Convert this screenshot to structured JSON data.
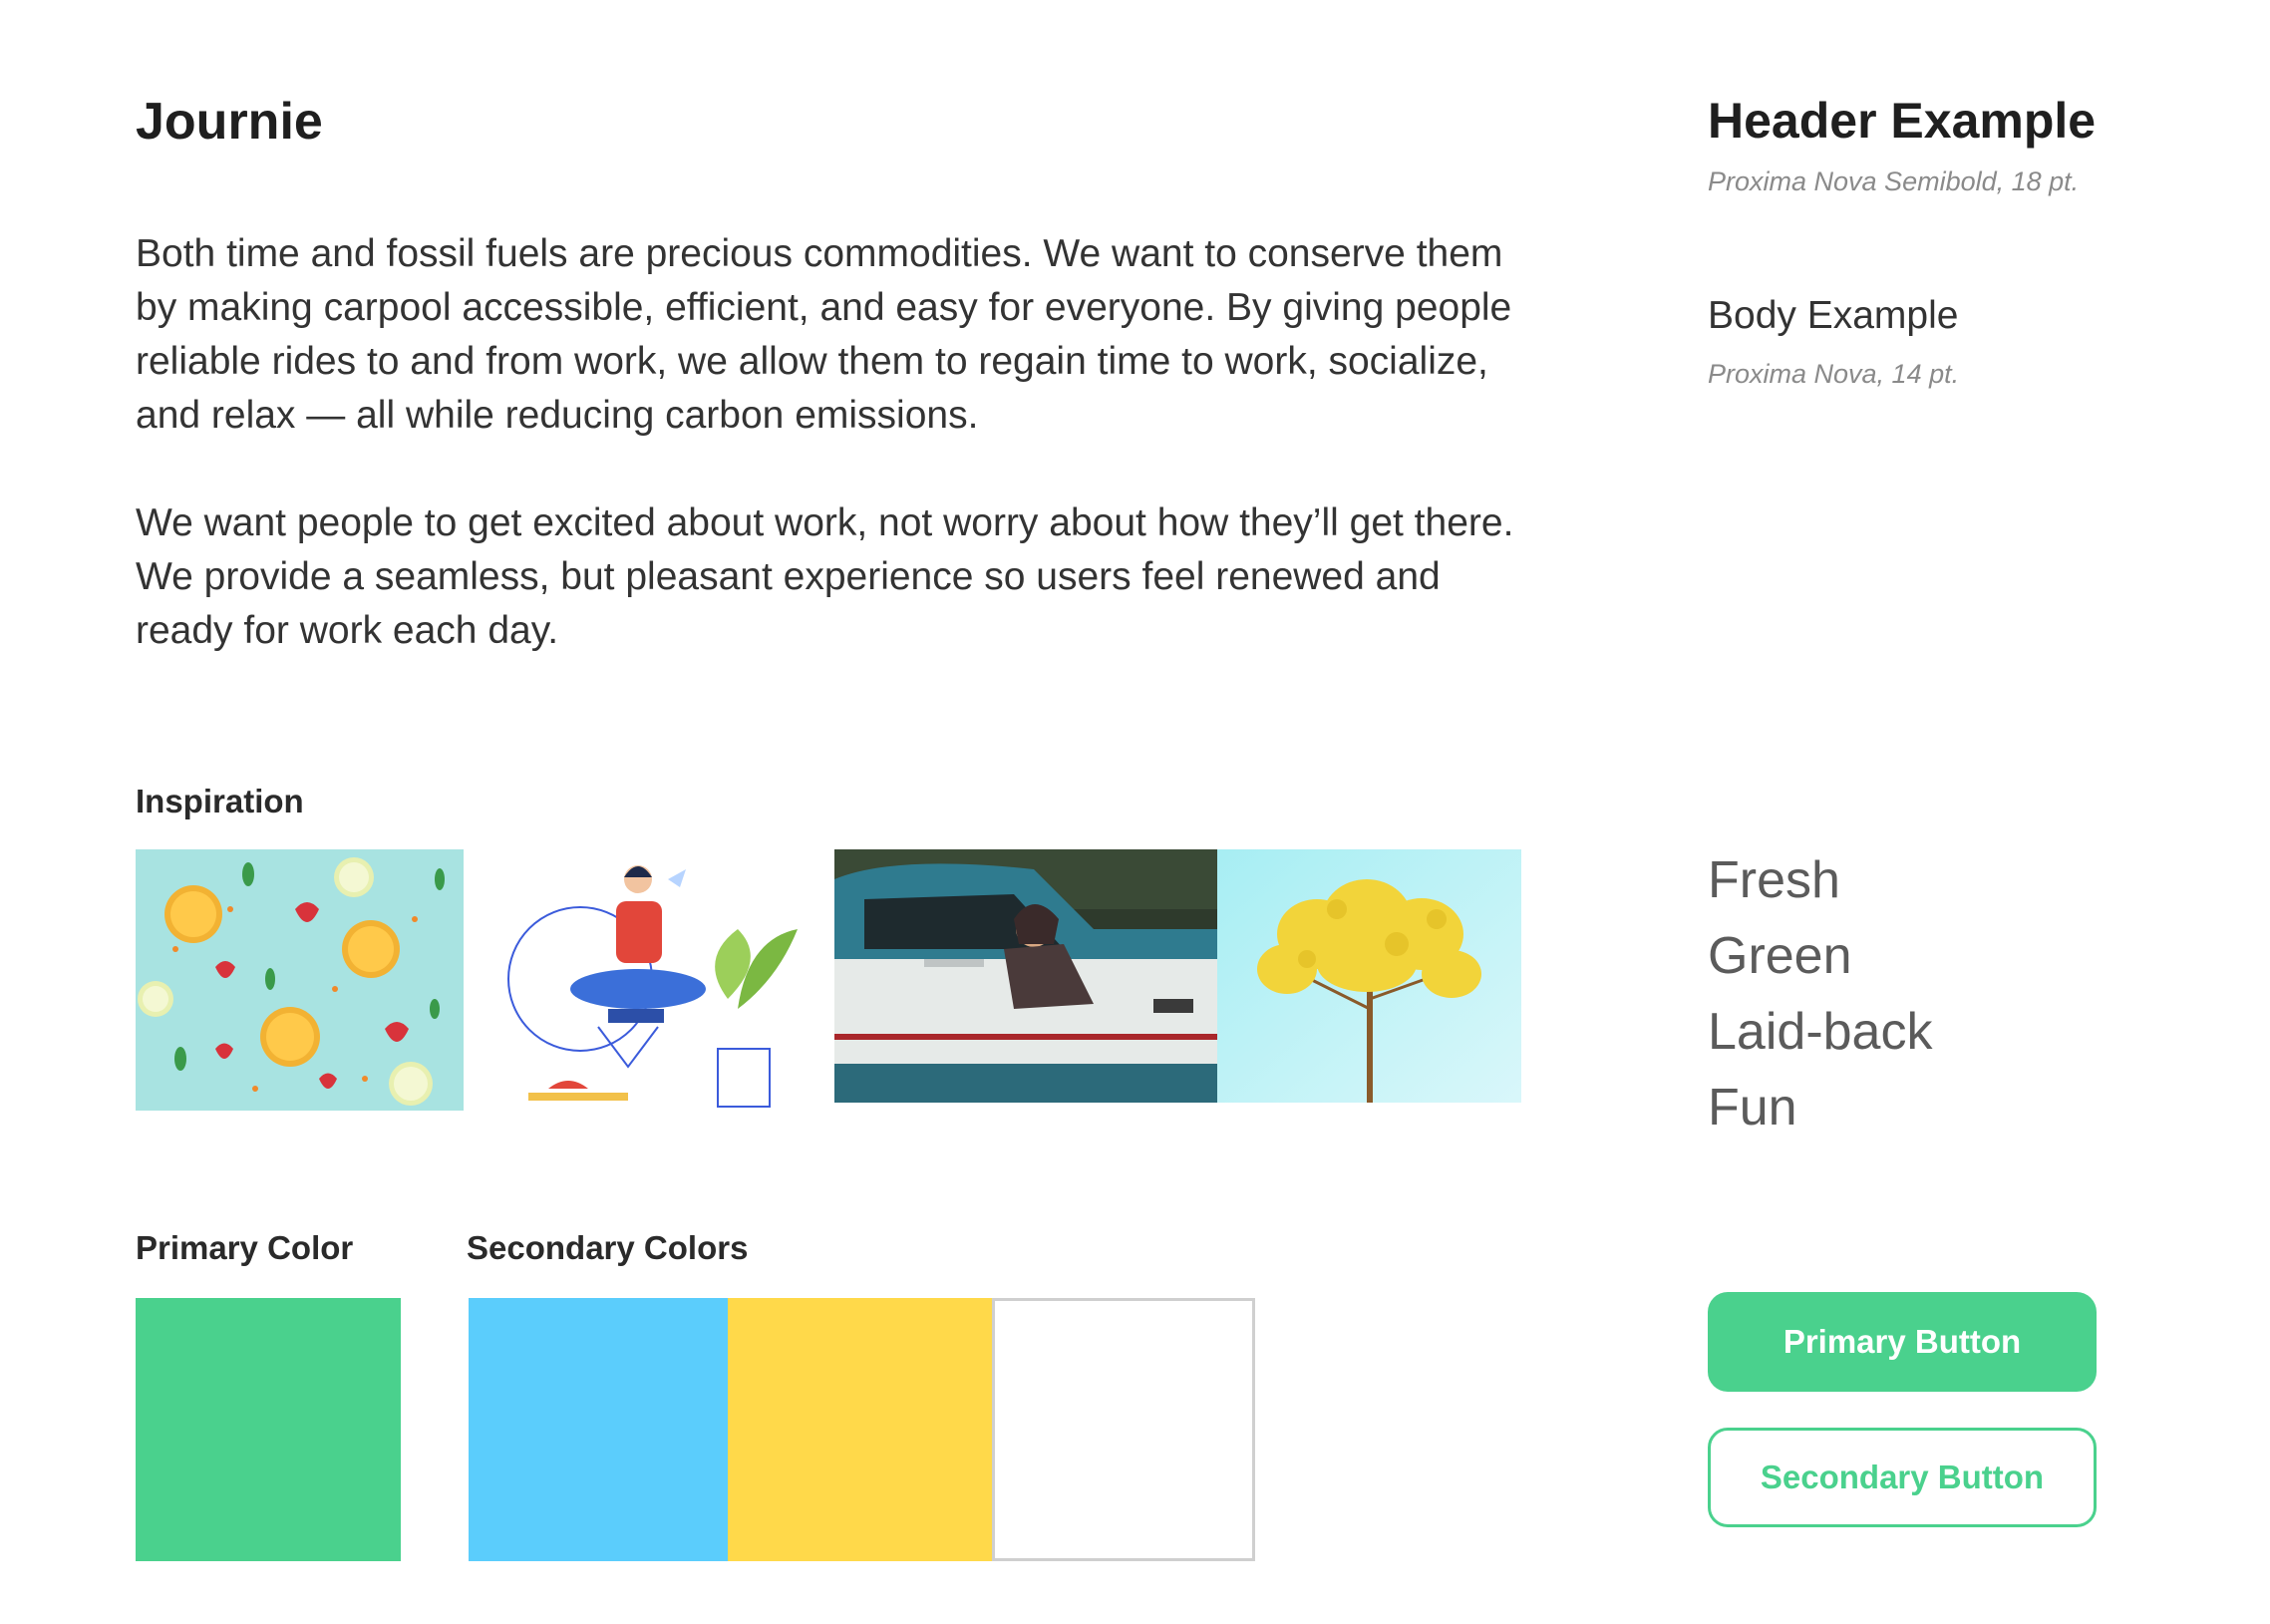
{
  "brand": {
    "title": "Journie",
    "paragraphs": [
      "Both time and fossil fuels are precious commodities. We want to conserve them by making carpool accessible, efficient, and easy for everyone. By giving people reliable rides to and from work, we allow them to regain time to work, socialize, and relax — all while reducing carbon emissions.",
      "We want people to get excited about work, not worry about how they’ll get there. We provide a seamless, but pleasant experience so users feel renewed and ready for work each day."
    ]
  },
  "inspiration": {
    "label": "Inspiration",
    "images": [
      "citrus-pattern-photo",
      "meditating-person-illustration",
      "vintage-truck-photo",
      "yellow-tree-photo"
    ]
  },
  "colors": {
    "primary_label": "Primary Color",
    "secondary_label": "Secondary Colors",
    "primary": "#4AD18D",
    "secondary": [
      "#5BCDFC",
      "#FFD94A",
      "#FFFFFF"
    ]
  },
  "typography": {
    "header_example": "Header Example",
    "header_spec": "Proxima Nova Semibold,  18 pt.",
    "body_example": "Body Example",
    "body_spec": "Proxima Nova,  14 pt."
  },
  "keywords": [
    "Fresh",
    "Green",
    "Laid-back",
    "Fun"
  ],
  "buttons": {
    "primary_label": "Primary Button",
    "secondary_label": "Secondary Button"
  }
}
